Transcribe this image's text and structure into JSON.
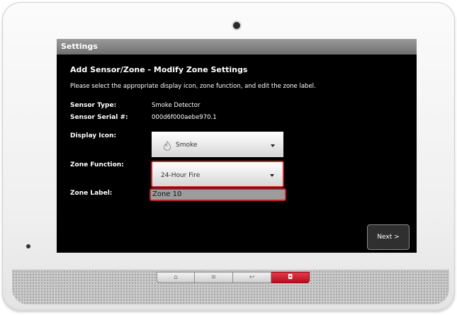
{
  "screen": {
    "title": "Settings",
    "heading": "Add Sensor/Zone - Modify Zone Settings",
    "instruction": "Please select the appropriate display icon, zone function, and edit the zone label."
  },
  "fields": {
    "sensor_type": {
      "label": "Sensor Type:",
      "value": "Smoke Detector"
    },
    "sensor_serial": {
      "label": "Sensor Serial #:",
      "value": "000d6f000aebe970.1"
    },
    "display_icon": {
      "label": "Display Icon:",
      "value": "Smoke",
      "icon": "flame-icon"
    },
    "zone_function": {
      "label": "Zone Function:",
      "value": "24-Hour Fire"
    },
    "zone_label": {
      "label": "Zone Label:",
      "value": "Zone 10"
    }
  },
  "buttons": {
    "next": "Next >"
  },
  "hardware_buttons": [
    {
      "name": "home-button",
      "icon": "home-icon",
      "glyph": "⌂"
    },
    {
      "name": "menu-button",
      "icon": "menu-icon",
      "glyph": "≡"
    },
    {
      "name": "back-button",
      "icon": "back-icon",
      "glyph": "↩"
    },
    {
      "name": "alarm-button",
      "icon": "alarm-icon",
      "glyph": "◘"
    }
  ],
  "colors": {
    "highlight": "#c8262c",
    "alarm_button": "#d42031",
    "titlebar": "#808080"
  }
}
